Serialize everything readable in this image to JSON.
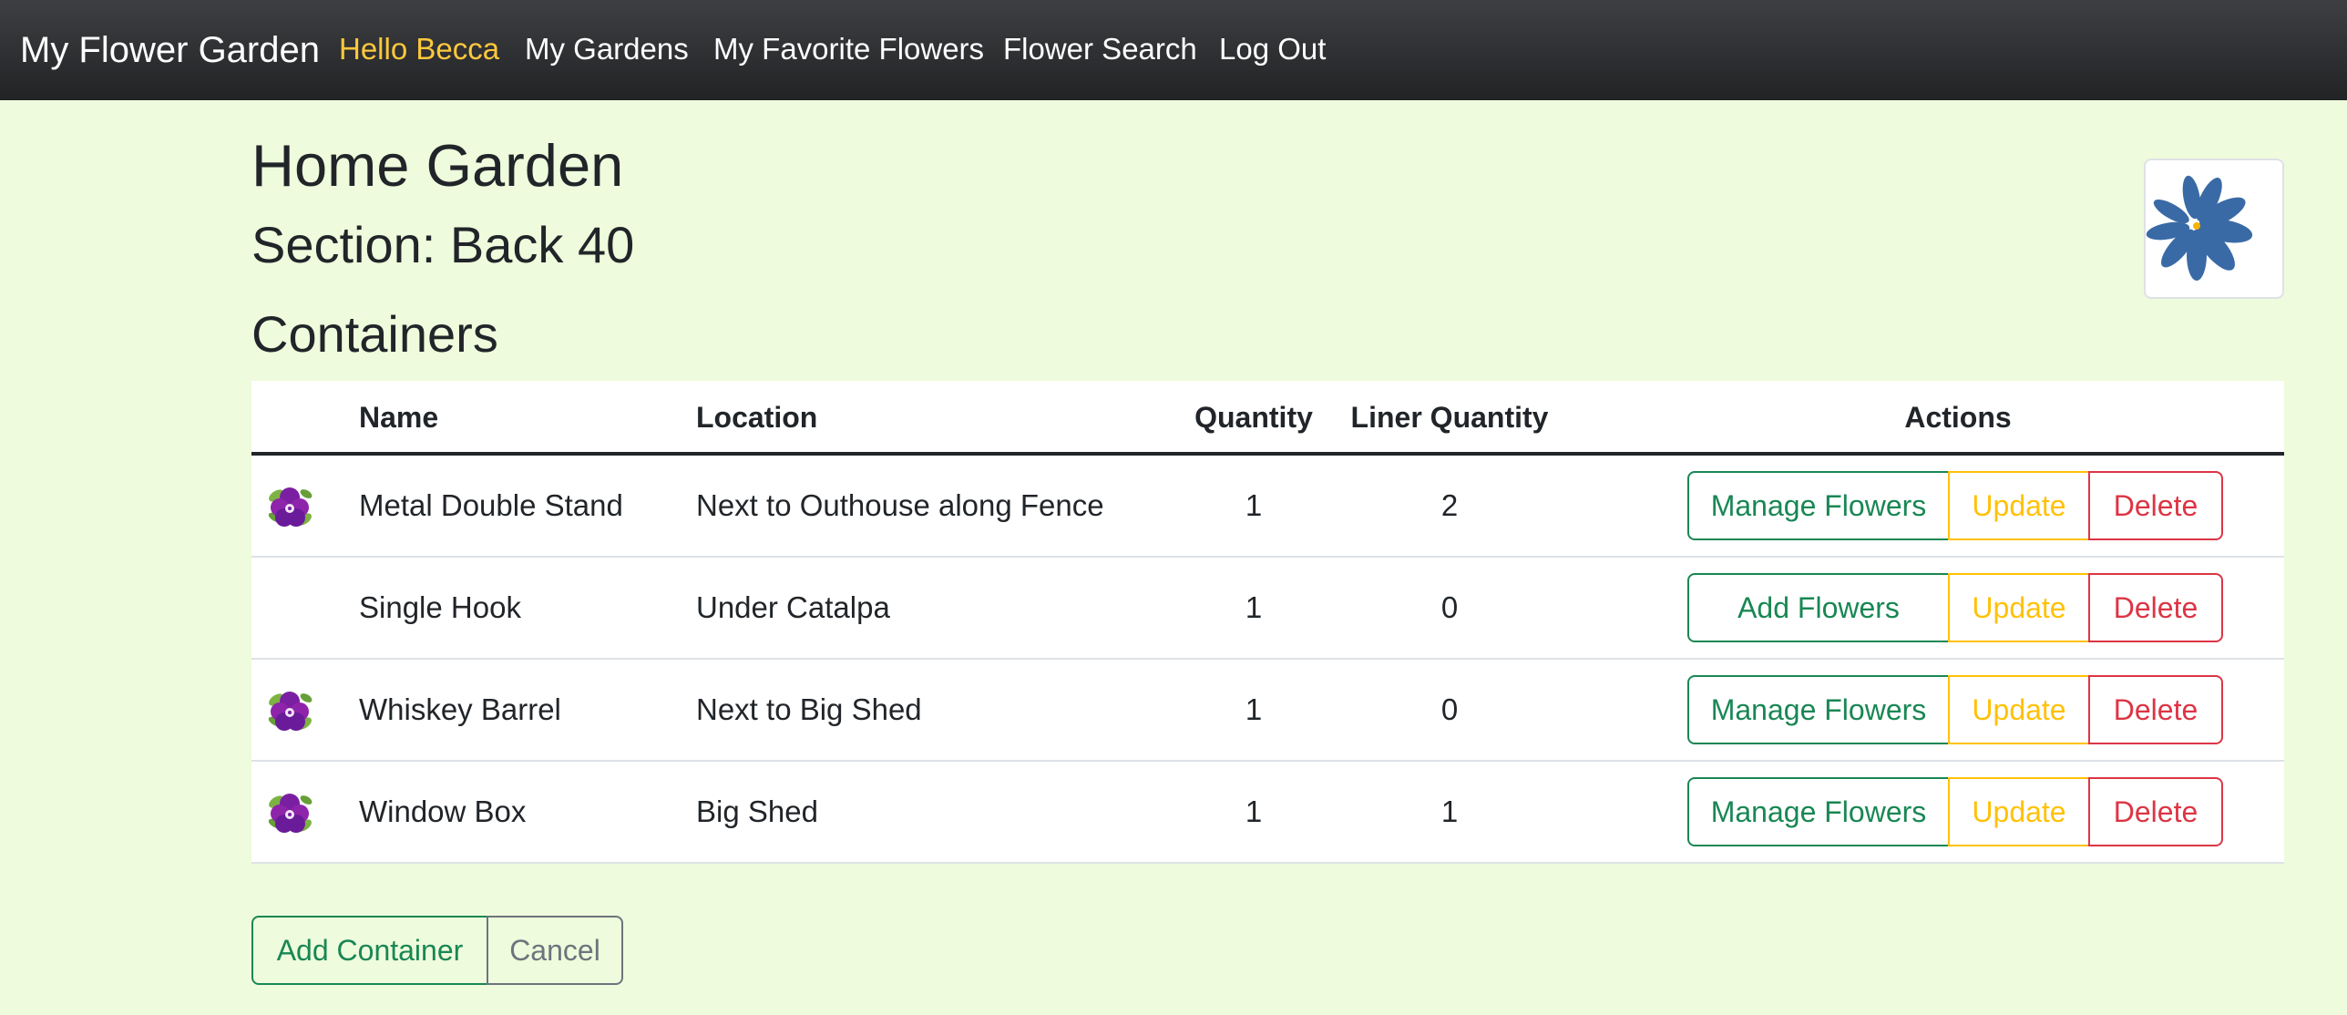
{
  "navbar": {
    "brand": "My Flower Garden",
    "greeting": "Hello Becca",
    "links": [
      "My Gardens",
      "My Favorite Flowers",
      "Flower Search",
      "Log Out"
    ],
    "accent_color": "#ffc83d"
  },
  "page": {
    "garden_title": "Home Garden",
    "section_title": "Section: Back 40",
    "containers_title": "Containers",
    "logo_icon": "flower-logo-icon"
  },
  "table": {
    "headers": [
      "",
      "Name",
      "Location",
      "Quantity",
      "Liner Quantity",
      "Actions"
    ],
    "rows": [
      {
        "has_icon": true,
        "icon": "flower-icon",
        "name": "Metal Double Stand",
        "location": "Next to Outhouse along Fence",
        "quantity": "1",
        "liner_quantity": "2",
        "primary_action": "Manage Flowers",
        "update": "Update",
        "delete": "Delete"
      },
      {
        "has_icon": false,
        "icon": "",
        "name": "Single Hook",
        "location": "Under Catalpa",
        "quantity": "1",
        "liner_quantity": "0",
        "primary_action": "Add Flowers",
        "update": "Update",
        "delete": "Delete"
      },
      {
        "has_icon": true,
        "icon": "flower-icon",
        "name": "Whiskey Barrel",
        "location": "Next to Big Shed",
        "quantity": "1",
        "liner_quantity": "0",
        "primary_action": "Manage Flowers",
        "update": "Update",
        "delete": "Delete"
      },
      {
        "has_icon": true,
        "icon": "flower-icon",
        "name": "Window Box",
        "location": "Big Shed",
        "quantity": "1",
        "liner_quantity": "1",
        "primary_action": "Manage Flowers",
        "update": "Update",
        "delete": "Delete"
      }
    ]
  },
  "footer_buttons": {
    "add_container": "Add Container",
    "cancel": "Cancel"
  },
  "colors": {
    "background": "#eefbdc",
    "navbar": "#2b2d30",
    "success": "#198754",
    "warning": "#ffc107",
    "danger": "#dc3545",
    "secondary": "#6c757d"
  }
}
